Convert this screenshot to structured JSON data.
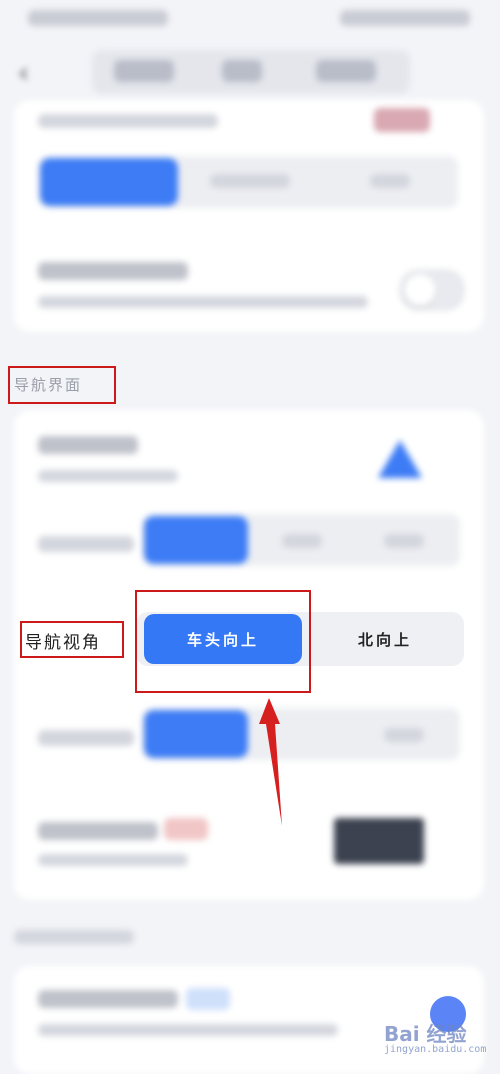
{
  "annotations": {
    "section_label": "导航界面",
    "row_label": "导航视角"
  },
  "view_mode": {
    "options": [
      "车头向上",
      "北向上"
    ],
    "selected_index": 0
  },
  "watermark": {
    "logo_text": "Bai 经验",
    "url": "jingyan.baidu.com"
  },
  "colors": {
    "accent": "#3478f6",
    "annotation_red": "#cc1a1a"
  },
  "icons": {
    "back": "chevron-left-icon",
    "arrow": "up-arrow-annotation-icon",
    "nav_direction": "triangle-icon"
  }
}
